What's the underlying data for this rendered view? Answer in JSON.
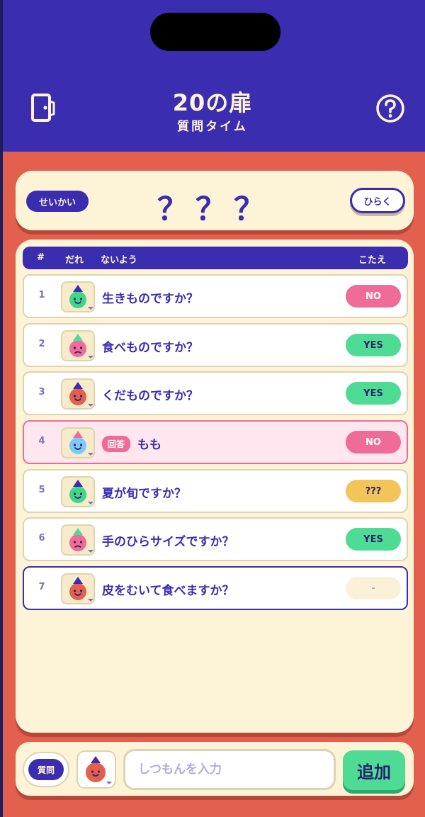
{
  "header": {
    "title": "20の扉",
    "subtitle": "質問タイム",
    "color": "#3b2db0"
  },
  "answer_card": {
    "label": "せいかい",
    "masked": "？？？",
    "reveal_label": "ひらく"
  },
  "table": {
    "col_num": "#",
    "col_who": "だれ",
    "col_what": "ないよう",
    "col_answer": "こたえ"
  },
  "rows": [
    {
      "num": "1",
      "who_color": "#3fd68a",
      "hat": "#3b2db0",
      "mood": "happy",
      "text": "生きものですか？",
      "badge": "",
      "answer": "NO",
      "answer_kind": "no"
    },
    {
      "num": "2",
      "who_color": "#ef6b98",
      "hat": "#4edc95",
      "mood": "sad",
      "text": "食べものですか？",
      "badge": "",
      "answer": "YES",
      "answer_kind": "yes"
    },
    {
      "num": "3",
      "who_color": "#e2604d",
      "hat": "#3b2db0",
      "mood": "happy",
      "text": "くだものですか？",
      "badge": "",
      "answer": "YES",
      "answer_kind": "yes"
    },
    {
      "num": "4",
      "who_color": "#7ec9f5",
      "hat": "#ef6b98",
      "mood": "happy",
      "text": "もも",
      "badge": "回答",
      "answer": "NO",
      "answer_kind": "no"
    },
    {
      "num": "5",
      "who_color": "#3fd68a",
      "hat": "#3b2db0",
      "mood": "happy",
      "text": "夏が旬ですか？",
      "badge": "",
      "answer": "???",
      "answer_kind": "unknown"
    },
    {
      "num": "6",
      "who_color": "#ef6b98",
      "hat": "#4edc95",
      "mood": "sad",
      "text": "手のひらサイズですか？",
      "badge": "",
      "answer": "YES",
      "answer_kind": "yes"
    },
    {
      "num": "7",
      "who_color": "#e2604d",
      "hat": "#3b2db0",
      "mood": "happy",
      "text": "皮をむいて食べますか？",
      "badge": "",
      "answer": "-",
      "answer_kind": "none"
    }
  ],
  "input_bar": {
    "mode_label": "質問",
    "asker_color": "#e2604d",
    "placeholder": "しつもんを入力",
    "value": "",
    "add_label": "追加"
  },
  "icons": {
    "door": "door-icon",
    "help": "help-icon",
    "avatar": "character-avatar",
    "dropdown": "dropdown-caret-icon"
  },
  "colors": {
    "background": "#e2604d",
    "panel": "#fdf3d6",
    "no": "#ef6b98",
    "yes": "#4edc95",
    "unknown": "#f3c457"
  }
}
